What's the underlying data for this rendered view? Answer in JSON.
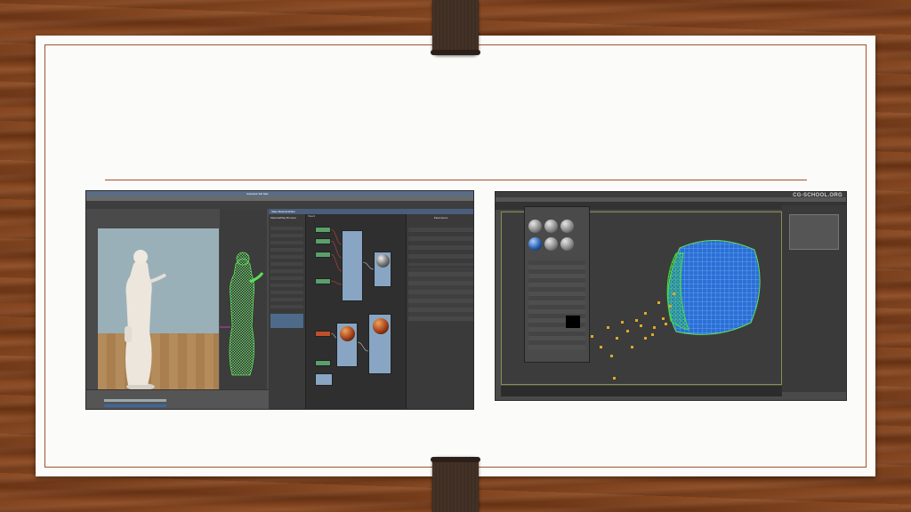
{
  "slide": {
    "title": "",
    "colors": {
      "accent": "#a0522d",
      "background": "#fbfbfa"
    }
  },
  "screenshot_left": {
    "window_title": "Autodesk 3ds Max",
    "editor_title": "Slate Material Editor",
    "panel_header": "Material/Map Browser",
    "view_tab": "View1",
    "params_header": "Parameters",
    "icons": [
      "statue-photo",
      "wireframe-statue",
      "node-graph",
      "material-sphere"
    ]
  },
  "screenshot_right": {
    "watermark": "CG-SCHOOL.ORG",
    "icons": [
      "material-balls",
      "particle-flow",
      "wireframe-vase"
    ]
  }
}
